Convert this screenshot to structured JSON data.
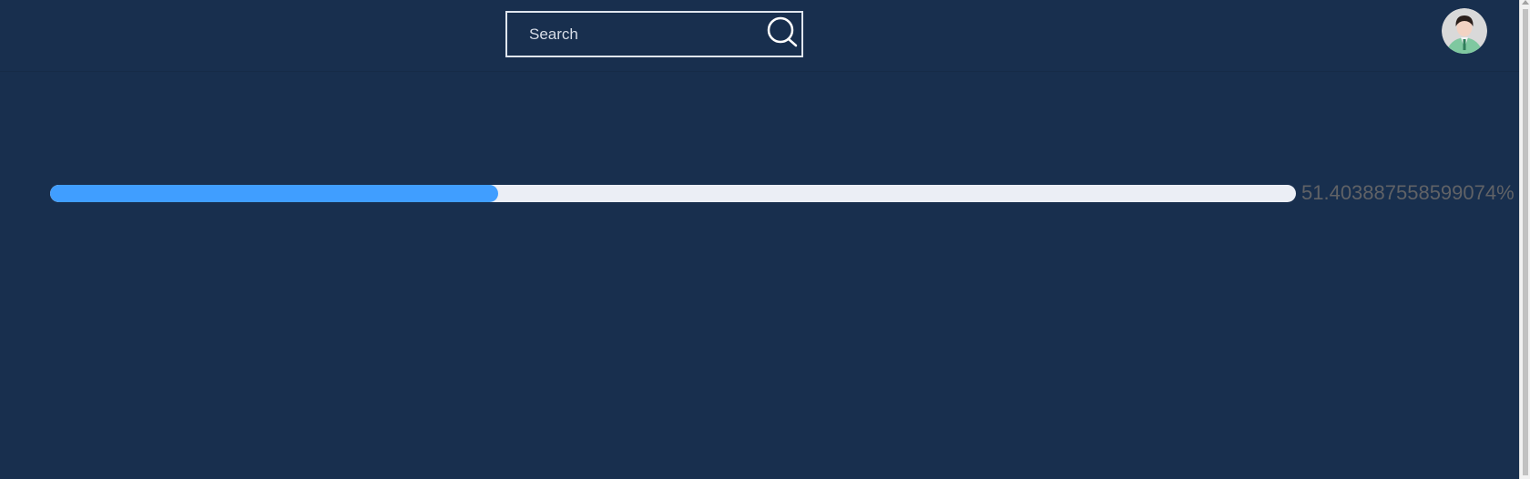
{
  "header": {
    "search": {
      "placeholder": "Search",
      "value": "",
      "icon": "search-icon"
    },
    "avatar": {
      "icon": "user-avatar-icon"
    }
  },
  "progress": {
    "percent": 51.403887558599074,
    "label": "51.403887558599074%",
    "fill_color": "#409eff",
    "track_color": "#ebeef5"
  },
  "colors": {
    "background": "#182f4e",
    "search_border": "#dfe5ee",
    "progress_text": "#606266"
  }
}
